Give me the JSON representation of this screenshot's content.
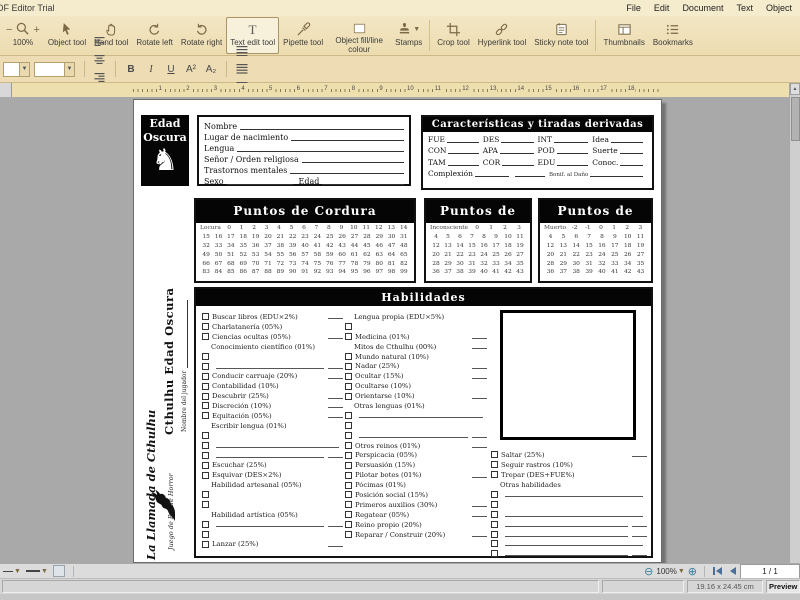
{
  "window": {
    "title": "PDF Editor Trial"
  },
  "menubar": {
    "items": [
      "File",
      "Edit",
      "Document",
      "Text",
      "Object"
    ]
  },
  "toolbar": {
    "zoom_value": "100%",
    "tools": [
      {
        "name": "object-tool",
        "icon": "pointer-icon",
        "label": "Object tool"
      },
      {
        "name": "hand-tool",
        "icon": "hand-icon",
        "label": "Hand tool"
      },
      {
        "name": "rotate-left",
        "icon": "rotate-left-icon",
        "label": "Rotate left"
      },
      {
        "name": "rotate-right",
        "icon": "rotate-right-icon",
        "label": "Rotate right"
      },
      {
        "name": "text-edit-tool",
        "icon": "text-icon",
        "label": "Text edit tool",
        "active": true
      },
      {
        "name": "pipette-tool",
        "icon": "pipette-icon",
        "label": "Pipette tool"
      },
      {
        "name": "object-fill-line-colour",
        "icon": "fill-colour-icon",
        "label": "Object fill/line colour"
      },
      {
        "name": "stamps",
        "icon": "stamp-icon",
        "label": "Stamps",
        "dropdown": true
      },
      {
        "name": "crop-tool",
        "icon": "crop-icon",
        "label": "Crop tool",
        "sep": true
      },
      {
        "name": "hyperlink-tool",
        "icon": "hyperlink-icon",
        "label": "Hyperlink tool"
      },
      {
        "name": "sticky-note-tool",
        "icon": "sticky-note-icon",
        "label": "Sticky note tool"
      },
      {
        "name": "thumbnails",
        "icon": "thumbnails-icon",
        "label": "Thumbnails",
        "sep": true
      },
      {
        "name": "bookmarks",
        "icon": "bookmarks-icon",
        "label": "Bookmarks"
      }
    ]
  },
  "format_toolbar": {
    "bold_label": "B",
    "italic_label": "I",
    "underline_label": "U",
    "superscript_label": "A²",
    "subscript_label": "A₂",
    "align_icons": [
      "align-left-icon",
      "align-center-icon",
      "align-right-icon",
      "align-justify-icon"
    ],
    "spacing_icons": [
      "line-spacing-1-icon",
      "line-spacing-15-icon",
      "line-spacing-2-icon"
    ]
  },
  "ruler": {
    "numbers": [
      "1",
      "2",
      "3",
      "4",
      "5",
      "6",
      "7",
      "8",
      "9",
      "10",
      "11",
      "12",
      "13",
      "14",
      "15",
      "16",
      "17",
      "18"
    ]
  },
  "sheet": {
    "logo": {
      "line1": "Edad",
      "line2": "Oscura"
    },
    "personal_box": {
      "lines": [
        "Nombre",
        "Lugar de nacimiento",
        "Lengua",
        "Señor / Orden religiosa",
        "Trastornos mentales"
      ],
      "sex_label": "Sexo",
      "age_label": "Edad"
    },
    "stats_box": {
      "title": "Características y tiradas derivadas",
      "grid": [
        [
          "FUE",
          "DES",
          "INT",
          "Idea"
        ],
        [
          "CON",
          "APA",
          "POD",
          "Suerte"
        ],
        [
          "TAM",
          "COR",
          "EDU",
          "Conoc."
        ]
      ],
      "complexion_label": "Complexión",
      "bonus_label": "Bonif. al Daño"
    },
    "trackers": [
      {
        "title": "Puntos de Cordura",
        "rows": [
          [
            "Locura",
            "0",
            "1",
            "2",
            "3",
            "4",
            "5",
            "6",
            "7",
            "8",
            "9",
            "10",
            "11",
            "12",
            "13",
            "14"
          ],
          [
            "15",
            "16",
            "17",
            "18",
            "19",
            "20",
            "21",
            "22",
            "23",
            "24",
            "25",
            "26",
            "27",
            "28",
            "29",
            "30",
            "31"
          ],
          [
            "32",
            "33",
            "34",
            "35",
            "36",
            "37",
            "38",
            "39",
            "40",
            "41",
            "42",
            "43",
            "44",
            "45",
            "46",
            "47",
            "48"
          ],
          [
            "49",
            "50",
            "51",
            "52",
            "53",
            "54",
            "55",
            "56",
            "57",
            "58",
            "59",
            "60",
            "61",
            "62",
            "63",
            "64",
            "65"
          ],
          [
            "66",
            "67",
            "68",
            "69",
            "70",
            "71",
            "72",
            "73",
            "74",
            "75",
            "76",
            "77",
            "78",
            "79",
            "80",
            "81",
            "82"
          ],
          [
            "83",
            "84",
            "85",
            "86",
            "87",
            "88",
            "89",
            "90",
            "91",
            "92",
            "93",
            "94",
            "95",
            "96",
            "97",
            "98",
            "99"
          ]
        ]
      },
      {
        "title": "Puntos de Magia",
        "rows": [
          [
            "Inconsciente",
            "0",
            "1",
            "2",
            "3"
          ],
          [
            "4",
            "5",
            "6",
            "7",
            "8",
            "9",
            "10",
            "11"
          ],
          [
            "12",
            "13",
            "14",
            "15",
            "16",
            "17",
            "18",
            "19"
          ],
          [
            "20",
            "21",
            "22",
            "23",
            "24",
            "25",
            "26",
            "27"
          ],
          [
            "28",
            "29",
            "30",
            "31",
            "32",
            "33",
            "34",
            "35"
          ],
          [
            "36",
            "37",
            "38",
            "39",
            "40",
            "41",
            "42",
            "43"
          ]
        ]
      },
      {
        "title": "Puntos de Vida",
        "rows": [
          [
            "Muerto",
            "-2",
            "-1",
            "0",
            "1",
            "2",
            "3"
          ],
          [
            "4",
            "5",
            "6",
            "7",
            "8",
            "9",
            "10",
            "11"
          ],
          [
            "12",
            "13",
            "14",
            "15",
            "16",
            "17",
            "18",
            "19"
          ],
          [
            "20",
            "21",
            "22",
            "23",
            "24",
            "25",
            "26",
            "27"
          ],
          [
            "28",
            "29",
            "30",
            "31",
            "32",
            "33",
            "34",
            "35"
          ],
          [
            "36",
            "37",
            "38",
            "39",
            "40",
            "41",
            "42",
            "43"
          ]
        ]
      }
    ],
    "skills": {
      "title": "Habilidades",
      "columns": [
        [
          {
            "b": 1,
            "t": "Buscar libros (EDU×2%)",
            "s": 1
          },
          {
            "b": 1,
            "t": "Charlatanería (05%)"
          },
          {
            "b": 1,
            "t": "Ciencias ocultas (05%)",
            "s": 1
          },
          {
            "t": "Conocimiento científico (01%)"
          },
          {
            "b": 1,
            "t": ""
          },
          {
            "b": 1,
            "u": 1,
            "s": 1
          },
          {
            "b": 1,
            "t": "Conducir carruaje (20%)",
            "s": 1
          },
          {
            "b": 1,
            "t": "Contabilidad (10%)"
          },
          {
            "b": 1,
            "t": "Descubrir (25%)",
            "s": 1
          },
          {
            "b": 1,
            "t": "Discreción (10%)",
            "s": 1
          },
          {
            "b": 1,
            "t": "Equitación (05%)",
            "s": 1
          },
          {
            "t": "Escribir lengua (01%)"
          },
          {
            "b": 1,
            "t": ""
          },
          {
            "b": 1,
            "u": 1
          },
          {
            "b": 1,
            "u": 1,
            "s": 1
          },
          {
            "b": 1,
            "t": "Escuchar (25%)"
          },
          {
            "b": 1,
            "t": "Esquivar (DES×2%)"
          },
          {
            "t": "Habilidad artesanal (05%)"
          },
          {
            "b": 1,
            "t": ""
          },
          {
            "b": 1,
            "t": ""
          },
          {
            "t": "Habilidad artística (05%)"
          },
          {
            "b": 1,
            "u": 1,
            "s": 1
          },
          {
            "b": 1,
            "t": ""
          },
          {
            "b": 1,
            "t": "Lanzar (25%)",
            "s": 1
          }
        ],
        [
          {
            "t": "Lengua propia (EDU×5%)"
          },
          {
            "b": 1,
            "t": ""
          },
          {
            "b": 1,
            "t": "Medicina (01%)",
            "s": 1
          },
          {
            "t": "Mitos de Cthulhu (00%)",
            "s": 1
          },
          {
            "b": 1,
            "t": "Mundo natural (10%)"
          },
          {
            "b": 1,
            "t": "Nadar (25%)",
            "s": 1
          },
          {
            "b": 1,
            "t": "Ocultar (15%)",
            "s": 1
          },
          {
            "b": 1,
            "t": "Ocultarse (10%)"
          },
          {
            "b": 1,
            "t": "Orientarse (10%)",
            "s": 1
          },
          {
            "t": "Otras lenguas (01%)"
          },
          {
            "b": 1,
            "u": 1
          },
          {
            "b": 1,
            "t": ""
          },
          {
            "b": 1,
            "u": 1,
            "s": 1
          },
          {
            "b": 1,
            "t": "Otros reinos (01%)",
            "s": 1
          },
          {
            "b": 1,
            "t": "Perspicacia (05%)"
          },
          {
            "b": 1,
            "t": "Persuasión (15%)"
          },
          {
            "b": 1,
            "t": "Pilotar botes (01%)",
            "s": 1
          },
          {
            "b": 1,
            "t": "Pócimas (01%)"
          },
          {
            "b": 1,
            "t": "Posición social (15%)"
          },
          {
            "b": 1,
            "t": "Primeros auxilios (30%)",
            "s": 1
          },
          {
            "b": 1,
            "t": "Regatear (05%)",
            "s": 1
          },
          {
            "b": 1,
            "t": "Reino propio (20%)"
          },
          {
            "b": 1,
            "t": "Reparar / Construir (20%)",
            "s": 1
          }
        ],
        [
          {
            "b": 1,
            "t": "Saltar (25%)",
            "s": 1
          },
          {
            "b": 1,
            "t": "Seguir rastros (10%)"
          },
          {
            "b": 1,
            "t": "Trepar (DES+FUE%)"
          },
          {
            "t": "Otras habilidades"
          },
          {
            "b": 1,
            "u": 1
          },
          {
            "b": 1,
            "t": ""
          },
          {
            "b": 1,
            "u": 1
          },
          {
            "b": 1,
            "u": 1,
            "s": 1
          },
          {
            "b": 1,
            "u": 1,
            "s": 1
          },
          {
            "b": 1,
            "u": 1
          },
          {
            "b": 1,
            "u": 1,
            "s": 1
          }
        ]
      ]
    },
    "side_band": {
      "product": "Cthulhu Edad Oscura",
      "player_label": "Nombre del jugador",
      "brand": "La Llamada de Cthulhu",
      "tagline": "Juego de Rol de Horror"
    }
  },
  "bottombar": {
    "zoom_value": "100%",
    "page_indicator": "1 / 1"
  },
  "statusbar": {
    "page_size": "19.16 x 24.45 cm",
    "mode": "Preview"
  }
}
